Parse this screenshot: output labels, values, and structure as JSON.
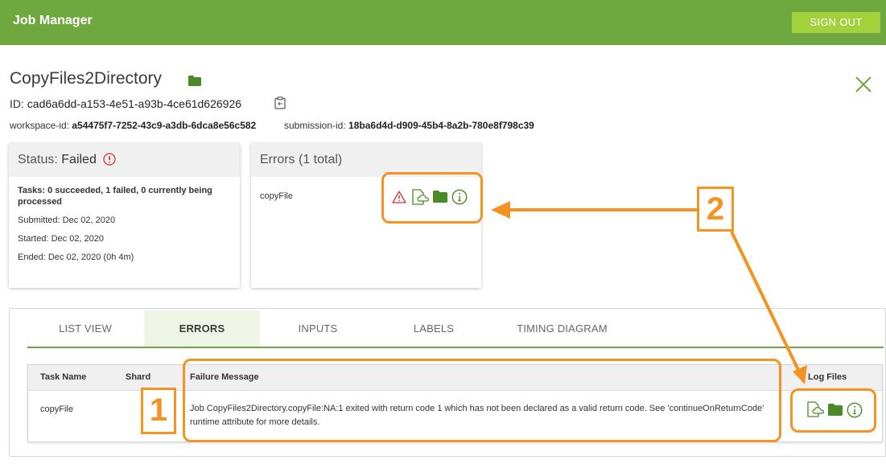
{
  "header": {
    "app_title": "Job Manager",
    "signout_label": "SIGN OUT"
  },
  "job": {
    "name": "CopyFiles2Directory",
    "id_label": "ID:",
    "id": "cad6a6dd-a153-4e51-a93b-4ce61d626926",
    "workspace_label": "workspace-id:",
    "workspace_id": "a54475f7-7252-43c9-a3db-6dca8e56c582",
    "submission_label": "submission-id:",
    "submission_id": "18ba6d4d-d909-45b4-8a2b-780e8f798c39"
  },
  "status_card": {
    "label": "Status:",
    "value": "Failed",
    "tasks": "Tasks: 0 succeeded, 1 failed, 0 currently being processed",
    "submitted": "Submitted: Dec 02, 2020",
    "started": "Started: Dec 02, 2020",
    "ended": "Ended: Dec 02, 2020 (0h 4m)"
  },
  "errors_card": {
    "title": "Errors (1 total)",
    "task_name": "copyFile"
  },
  "tabs": [
    {
      "label": "LIST VIEW",
      "active": false
    },
    {
      "label": "ERRORS",
      "active": true
    },
    {
      "label": "INPUTS",
      "active": false
    },
    {
      "label": "LABELS",
      "active": false
    },
    {
      "label": "TIMING DIAGRAM",
      "active": false
    }
  ],
  "errors_table": {
    "headers": [
      "Task Name",
      "Shard",
      "Failure Message",
      "Log Files"
    ],
    "rows": [
      {
        "task_name": "copyFile",
        "shard": "",
        "failure_message_line1": "Job CopyFiles2Directory.copyFile:NA:1 exited with return code 1 which has not been declared as a valid return code. See 'continueOnReturnCode'",
        "failure_message_line2": "runtime attribute for more details."
      }
    ]
  },
  "annotations": {
    "one": "1",
    "two": "2"
  },
  "colors": {
    "brand_green": "#6fa83f",
    "icon_green": "#4a8a26",
    "error_red": "#d9342b",
    "annotation_orange": "#f39321"
  },
  "icons": [
    "folder-icon",
    "close-icon",
    "copy-clipboard-icon",
    "error-icon",
    "warning-icon",
    "cloud-file-icon",
    "info-icon"
  ]
}
